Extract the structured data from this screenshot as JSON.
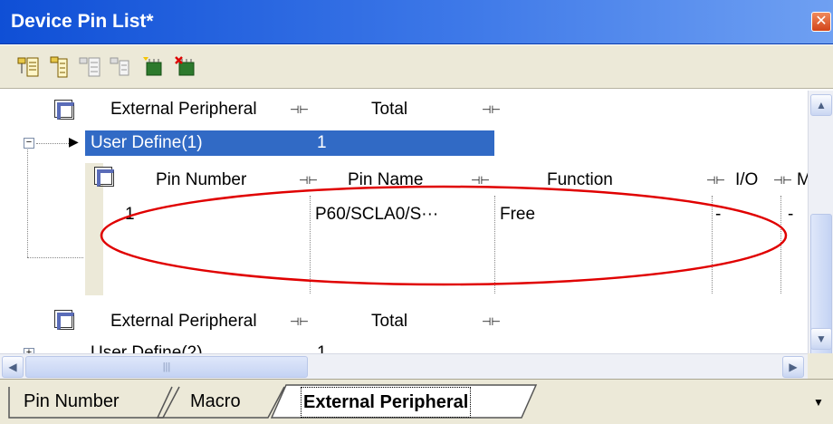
{
  "window": {
    "title": "Device Pin List*"
  },
  "toolbar": {
    "buttons": [
      {
        "icon": "expand-all-icon"
      },
      {
        "icon": "collapse-all-icon"
      },
      {
        "icon": "expand-selected-icon"
      },
      {
        "icon": "collapse-selected-icon"
      },
      {
        "icon": "add-define-icon"
      },
      {
        "icon": "remove-define-icon"
      }
    ]
  },
  "outer_table": {
    "headers": [
      "External Peripheral",
      "Total"
    ],
    "groups": [
      {
        "name": "User Define(1)",
        "total": "1"
      },
      {
        "name": "User Define(2)",
        "total": "1"
      }
    ]
  },
  "inner_table": {
    "headers": [
      "Pin Number",
      "Pin Name",
      "Function",
      "I/O",
      "M"
    ],
    "rows": [
      {
        "pin_number": "1",
        "pin_name": "P60/SCLA0/S···",
        "function": "Free",
        "io": "-",
        "m": "-"
      }
    ]
  },
  "annotation": {
    "color": "#e00000"
  },
  "tabs": [
    {
      "label": "Pin Number",
      "active": false
    },
    {
      "label": "Macro",
      "active": false
    },
    {
      "label": "External Peripheral",
      "active": true
    }
  ],
  "colors": {
    "title_bar": "#2a63e0",
    "selection": "#316ac5",
    "toolbar_bg": "#ece9d8"
  }
}
